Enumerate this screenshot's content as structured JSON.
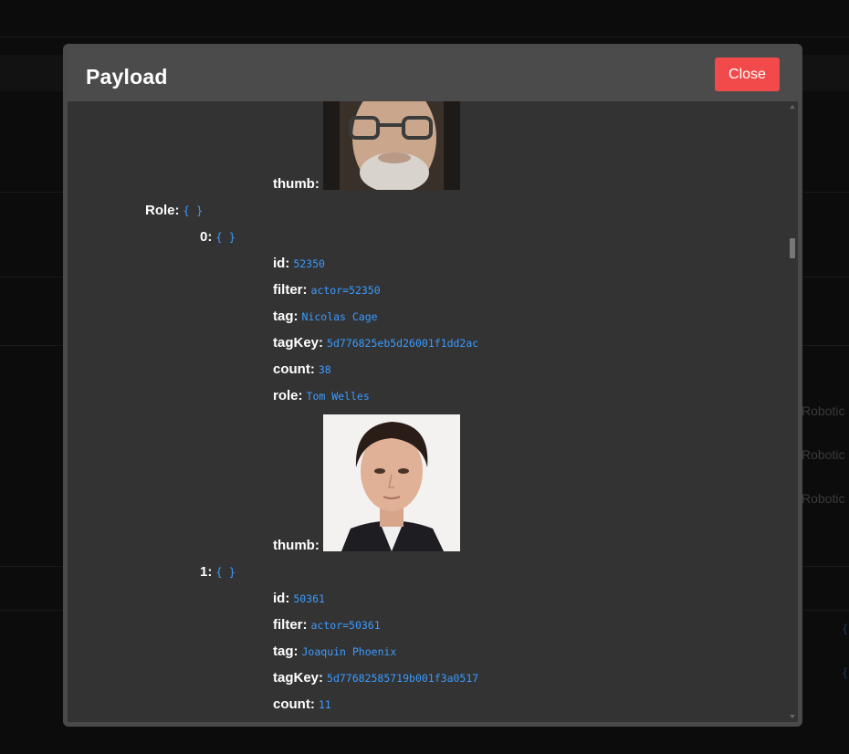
{
  "background": {
    "side_labels": [
      "Robotic",
      "Robotic",
      "Robotic"
    ],
    "side_braces": [
      "{",
      "{"
    ]
  },
  "modal": {
    "title": "Payload",
    "close_label": "Close"
  },
  "payload": {
    "prev_thumb_key": "thumb:",
    "role_key": "Role:",
    "role_brace": "{ }",
    "items": [
      {
        "index_key": "0:",
        "brace": "{ }",
        "id_key": "id:",
        "id": "52350",
        "filter_key": "filter:",
        "filter": "actor=52350",
        "tag_key": "tag:",
        "tag": "Nicolas Cage",
        "tagKey_key": "tagKey:",
        "tagKey": "5d776825eb5d26001f1dd2ac",
        "count_key": "count:",
        "count": "38",
        "role_key": "role:",
        "role": "Tom Welles",
        "thumb_key": "thumb:"
      },
      {
        "index_key": "1:",
        "brace": "{ }",
        "id_key": "id:",
        "id": "50361",
        "filter_key": "filter:",
        "filter": "actor=50361",
        "tag_key": "tag:",
        "tag": "Joaquin Phoenix",
        "tagKey_key": "tagKey:",
        "tagKey": "5d77682585719b001f3a0517",
        "count_key": "count:",
        "count": "11"
      }
    ]
  },
  "colors": {
    "accent_value": "#3b9bff",
    "close_button": "#f24a4a",
    "modal_bg": "#333333",
    "header_bg": "#4b4b4b"
  }
}
